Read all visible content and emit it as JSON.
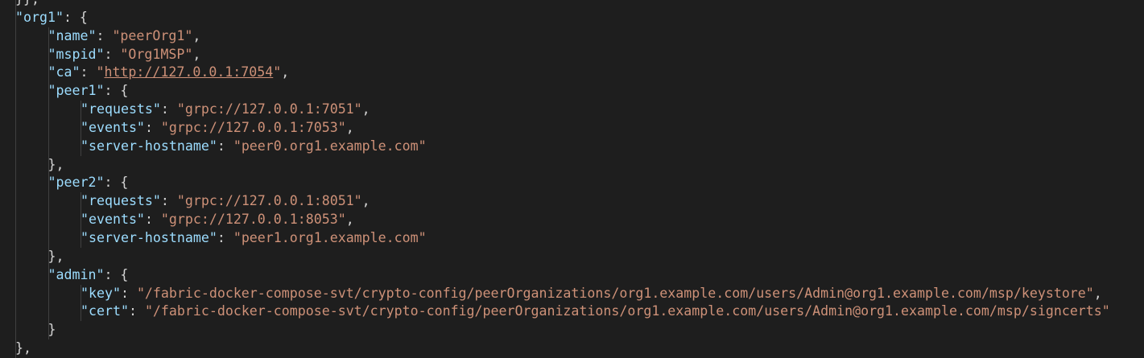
{
  "theme": {
    "background": "#1e1e1e",
    "key_color": "#9cdcfe",
    "string_color": "#ce9178",
    "punctuation_color": "#d4d4d4",
    "indent_guide_color": "#404040"
  },
  "lines": [
    {
      "indent": 1,
      "parts": [
        {
          "t": "p",
          "v": "}},"
        }
      ]
    },
    {
      "indent": 1,
      "parts": [
        {
          "t": "k",
          "v": "\"org1\""
        },
        {
          "t": "p",
          "v": ": {"
        }
      ]
    },
    {
      "indent": 2,
      "parts": [
        {
          "t": "k",
          "v": "\"name\""
        },
        {
          "t": "p",
          "v": ": "
        },
        {
          "t": "s",
          "v": "\"peerOrg1\""
        },
        {
          "t": "p",
          "v": ","
        }
      ]
    },
    {
      "indent": 2,
      "parts": [
        {
          "t": "k",
          "v": "\"mspid\""
        },
        {
          "t": "p",
          "v": ": "
        },
        {
          "t": "s",
          "v": "\"Org1MSP\""
        },
        {
          "t": "p",
          "v": ","
        }
      ]
    },
    {
      "indent": 2,
      "parts": [
        {
          "t": "k",
          "v": "\"ca\""
        },
        {
          "t": "p",
          "v": ": "
        },
        {
          "t": "s",
          "v": "\""
        },
        {
          "t": "l",
          "v": "http://127.0.0.1:7054"
        },
        {
          "t": "s",
          "v": "\""
        },
        {
          "t": "p",
          "v": ","
        }
      ]
    },
    {
      "indent": 2,
      "parts": [
        {
          "t": "k",
          "v": "\"peer1\""
        },
        {
          "t": "p",
          "v": ": {"
        }
      ]
    },
    {
      "indent": 3,
      "parts": [
        {
          "t": "k",
          "v": "\"requests\""
        },
        {
          "t": "p",
          "v": ": "
        },
        {
          "t": "s",
          "v": "\"grpc://127.0.0.1:7051\""
        },
        {
          "t": "p",
          "v": ","
        }
      ]
    },
    {
      "indent": 3,
      "parts": [
        {
          "t": "k",
          "v": "\"events\""
        },
        {
          "t": "p",
          "v": ": "
        },
        {
          "t": "s",
          "v": "\"grpc://127.0.0.1:7053\""
        },
        {
          "t": "p",
          "v": ","
        }
      ]
    },
    {
      "indent": 3,
      "parts": [
        {
          "t": "k",
          "v": "\"server-hostname\""
        },
        {
          "t": "p",
          "v": ": "
        },
        {
          "t": "s",
          "v": "\"peer0.org1.example.com\""
        }
      ]
    },
    {
      "indent": 2,
      "parts": [
        {
          "t": "p",
          "v": "},"
        }
      ]
    },
    {
      "indent": 2,
      "parts": [
        {
          "t": "k",
          "v": "\"peer2\""
        },
        {
          "t": "p",
          "v": ": {"
        }
      ]
    },
    {
      "indent": 3,
      "parts": [
        {
          "t": "k",
          "v": "\"requests\""
        },
        {
          "t": "p",
          "v": ": "
        },
        {
          "t": "s",
          "v": "\"grpc://127.0.0.1:8051\""
        },
        {
          "t": "p",
          "v": ","
        }
      ]
    },
    {
      "indent": 3,
      "parts": [
        {
          "t": "k",
          "v": "\"events\""
        },
        {
          "t": "p",
          "v": ": "
        },
        {
          "t": "s",
          "v": "\"grpc://127.0.0.1:8053\""
        },
        {
          "t": "p",
          "v": ","
        }
      ]
    },
    {
      "indent": 3,
      "parts": [
        {
          "t": "k",
          "v": "\"server-hostname\""
        },
        {
          "t": "p",
          "v": ": "
        },
        {
          "t": "s",
          "v": "\"peer1.org1.example.com\""
        }
      ]
    },
    {
      "indent": 2,
      "parts": [
        {
          "t": "p",
          "v": "},"
        }
      ]
    },
    {
      "indent": 2,
      "parts": [
        {
          "t": "k",
          "v": "\"admin\""
        },
        {
          "t": "p",
          "v": ": {"
        }
      ]
    },
    {
      "indent": 3,
      "parts": [
        {
          "t": "k",
          "v": "\"key\""
        },
        {
          "t": "p",
          "v": ": "
        },
        {
          "t": "s",
          "v": "\"/fabric-docker-compose-svt/crypto-config/peerOrganizations/org1.example.com/users/Admin@org1.example.com/msp/keystore\""
        },
        {
          "t": "p",
          "v": ","
        }
      ]
    },
    {
      "indent": 3,
      "parts": [
        {
          "t": "k",
          "v": "\"cert\""
        },
        {
          "t": "p",
          "v": ": "
        },
        {
          "t": "s",
          "v": "\"/fabric-docker-compose-svt/crypto-config/peerOrganizations/org1.example.com/users/Admin@org1.example.com/msp/signcerts\""
        }
      ]
    },
    {
      "indent": 2,
      "parts": [
        {
          "t": "p",
          "v": "}"
        }
      ]
    },
    {
      "indent": 1,
      "parts": [
        {
          "t": "p",
          "v": "},"
        }
      ]
    }
  ]
}
